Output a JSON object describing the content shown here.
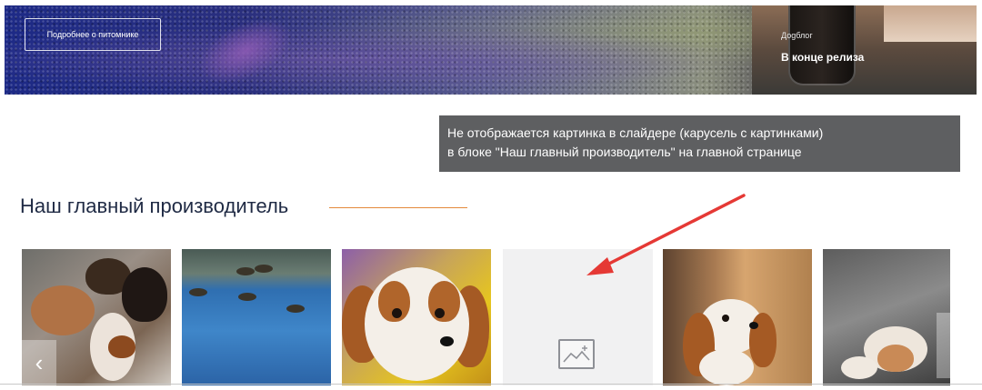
{
  "hero": {
    "button_label": "Подробнее о питомнике",
    "side_blog_label": "Доgблог",
    "side_title": "В конце релиза"
  },
  "annotation": {
    "text_line1": "Не отображается картинка в слайдере (карусель с картинками)",
    "text_line2": "в блоке \"Наш главный производитель\" на главной странице",
    "arrow_color": "#e53935"
  },
  "section": {
    "title": "Наш главный производитель",
    "rule_color": "#e4893b"
  },
  "carousel": {
    "slides": [
      {
        "label": "dog-photo-1",
        "broken": false
      },
      {
        "label": "ducks-photo",
        "broken": false
      },
      {
        "label": "puppy-photo",
        "broken": false
      },
      {
        "label": "broken-image",
        "broken": true
      },
      {
        "label": "dog-photo-door",
        "broken": false
      },
      {
        "label": "dog-photo-street",
        "broken": false
      }
    ],
    "prev_glyph": "‹",
    "broken_image_icon": "image-placeholder-icon"
  }
}
